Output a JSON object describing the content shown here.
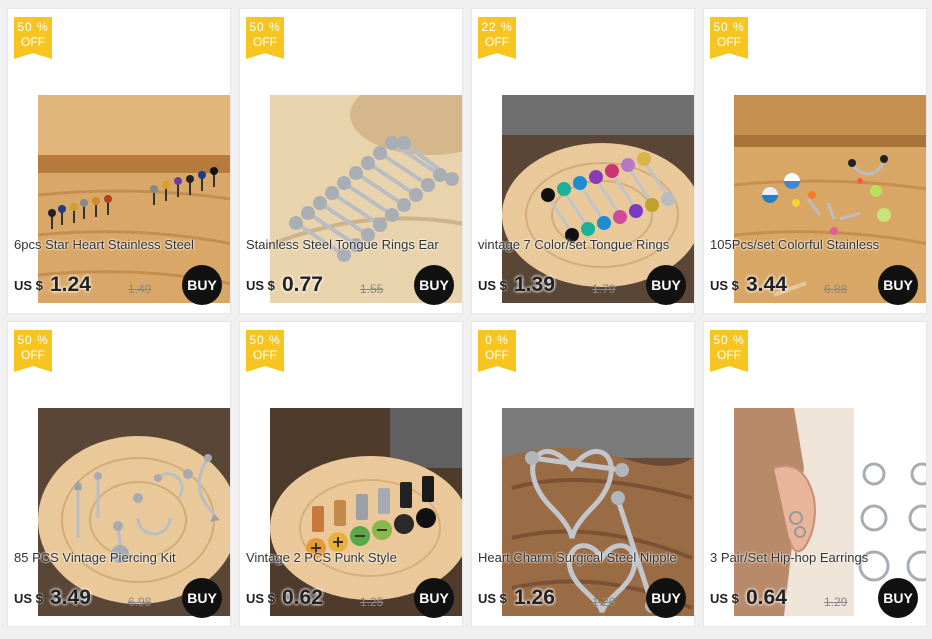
{
  "colors": {
    "badge": "#f6c51f",
    "buy_button": "#111111",
    "card_bg": "#ffffff",
    "page_bg": "#f0f0f0"
  },
  "products": [
    {
      "discount": "50 %",
      "off": "OFF",
      "title": "6pcs Star Heart Stainless Steel",
      "currency": "US $",
      "price": "1.24",
      "old_price": "1.49",
      "buy": "BUY",
      "image": "wood-board-small-studs"
    },
    {
      "discount": "50 %",
      "off": "OFF",
      "title": "Stainless Steel Tongue Rings Ear",
      "currency": "US $",
      "price": "0.77",
      "old_price": "1.55",
      "buy": "BUY",
      "image": "wood-barbells-silver"
    },
    {
      "discount": "22 %",
      "off": "OFF",
      "title": "vintage 7 Color/set Tongue Rings",
      "currency": "US $",
      "price": "1.39",
      "old_price": "1.79",
      "buy": "BUY",
      "image": "wood-slice-colored-barbells"
    },
    {
      "discount": "50 %",
      "off": "OFF",
      "title": "105Pcs/set Colorful Stainless",
      "currency": "US $",
      "price": "3.44",
      "old_price": "6.88",
      "buy": "BUY",
      "image": "wood-colorful-mix"
    },
    {
      "discount": "50 %",
      "off": "OFF",
      "title": "85 PCS Vintage Piercing Kit",
      "currency": "US $",
      "price": "3.49",
      "old_price": "6.98",
      "buy": "BUY",
      "image": "wood-slice-piercing-kit"
    },
    {
      "discount": "50 %",
      "off": "OFF",
      "title": "Vintage 2 PCS Punk Style",
      "currency": "US $",
      "price": "0.62",
      "old_price": "1.25",
      "buy": "BUY",
      "image": "wood-slice-screw-plugs"
    },
    {
      "discount": "0 %",
      "off": "OFF",
      "title": "Heart Charm Surgical Steel Nipple",
      "currency": "US $",
      "price": "1.26",
      "old_price": "1.26",
      "buy": "BUY",
      "image": "wood-heart-shields"
    },
    {
      "discount": "50 %",
      "off": "OFF",
      "title": "3 Pair/Set Hip-hop Earrings",
      "currency": "US $",
      "price": "0.64",
      "old_price": "1.29",
      "buy": "BUY",
      "image": "ear-and-hoops"
    }
  ]
}
